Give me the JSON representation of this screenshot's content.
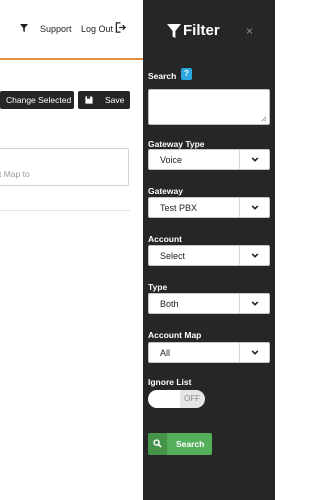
{
  "header": {
    "support_label": "Support",
    "logout_label": "Log Out"
  },
  "toolbar": {
    "change_selected_label": "Change Selected",
    "save_label": "Save"
  },
  "map_field": {
    "text": "t Map to"
  },
  "filter_panel": {
    "title": "Filter",
    "close_glyph": "×",
    "search": {
      "label": "Search",
      "help": "?",
      "value": ""
    },
    "gateway_type": {
      "label": "Gateway Type",
      "value": "Voice"
    },
    "gateway": {
      "label": "Gateway",
      "value": "Test PBX"
    },
    "account": {
      "label": "Account",
      "value": "Select"
    },
    "type": {
      "label": "Type",
      "value": "Both"
    },
    "account_map": {
      "label": "Account Map",
      "value": "All"
    },
    "ignore_list": {
      "label": "Ignore List",
      "state": "OFF"
    },
    "search_button_label": "Search"
  },
  "colors": {
    "panel_bg": "#262626",
    "accent_orange": "#e08e3c",
    "help_blue": "#2aa7de",
    "search_green": "#55b05b",
    "search_green_dark": "#45944a"
  },
  "icons": [
    "filter-icon",
    "logout-icon",
    "save-icon",
    "close-icon",
    "chevron-down-icon",
    "search-icon"
  ]
}
